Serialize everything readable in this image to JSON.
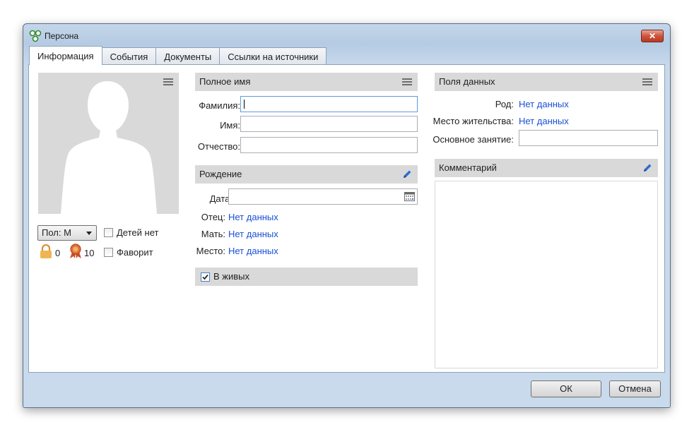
{
  "window": {
    "title": "Персона"
  },
  "tabs": [
    {
      "label": "Информация",
      "active": true
    },
    {
      "label": "События",
      "active": false
    },
    {
      "label": "Документы",
      "active": false
    },
    {
      "label": "Ссылки на источники",
      "active": false
    }
  ],
  "left": {
    "gender_select": "Пол: М",
    "no_children_label": "Детей нет",
    "no_children_checked": false,
    "favorite_label": "Фаворит",
    "favorite_checked": false,
    "lock_count": "0",
    "award_count": "10"
  },
  "fullname": {
    "header": "Полное имя",
    "surname_label": "Фамилия:",
    "surname_value": "",
    "name_label": "Имя:",
    "name_value": "",
    "patronymic_label": "Отчество:",
    "patronymic_value": ""
  },
  "birth": {
    "header": "Рождение",
    "date_label": "Дата:",
    "date_value": "",
    "father_label": "Отец:",
    "father_value": "Нет данных",
    "mother_label": "Мать:",
    "mother_value": "Нет данных",
    "place_label": "Место:",
    "place_value": "Нет данных"
  },
  "alive": {
    "label": "В живых",
    "checked": true
  },
  "datafields": {
    "header": "Поля данных",
    "clan_label": "Род:",
    "clan_value": "Нет данных",
    "residence_label": "Место жительства:",
    "residence_value": "Нет данных",
    "occupation_label": "Основное занятие:",
    "occupation_value": ""
  },
  "comment": {
    "header": "Комментарий"
  },
  "footer": {
    "ok_label": "ОК",
    "cancel_label": "Отмена"
  },
  "colors": {
    "link": "#1a4fd6",
    "section_bg": "#d9d9d9",
    "accent_pencil": "#2d6fd2"
  },
  "icons": [
    "app-tree-icon",
    "close-icon",
    "menu-icon",
    "pencil-icon",
    "calendar-icon",
    "lock-icon",
    "award-icon",
    "checkmark-icon",
    "silhouette-icon"
  ]
}
